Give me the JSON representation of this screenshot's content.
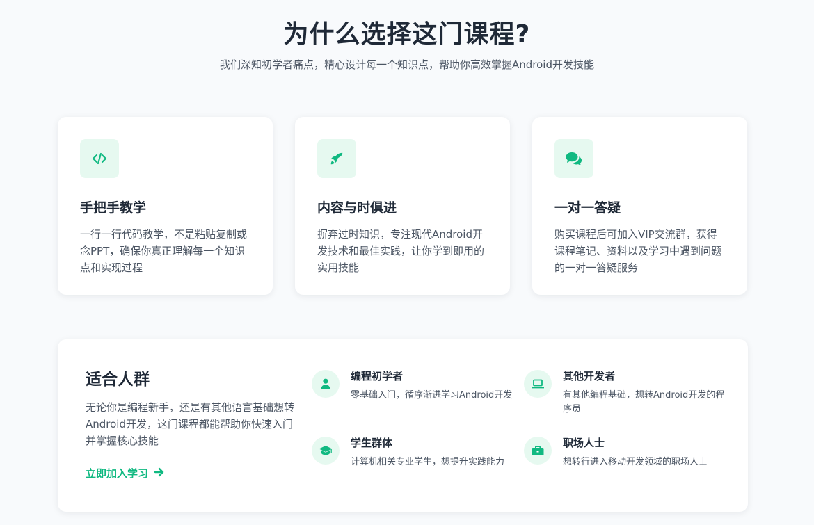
{
  "header": {
    "title": "为什么选择这门课程?",
    "subtitle": "我们深知初学者痛点，精心设计每一个知识点，帮助你高效掌握Android开发技能"
  },
  "features": [
    {
      "icon": "code-icon",
      "title": "手把手教学",
      "desc": "一行一行代码教学，不是粘贴复制或念PPT，确保你真正理解每一个知识点和实现过程"
    },
    {
      "icon": "rocket-icon",
      "title": "内容与时俱进",
      "desc": "摒弃过时知识，专注现代Android开发技术和最佳实践，让你学到即用的实用技能"
    },
    {
      "icon": "chat-icon",
      "title": "一对一答疑",
      "desc": "购买课程后可加入VIP交流群，获得课程笔记、资料以及学习中遇到问题的一对一答疑服务"
    }
  ],
  "audience": {
    "title": "适合人群",
    "desc": "无论你是编程新手，还是有其他语言基础想转Android开发，这门课程都能帮助你快速入门并掌握核心技能",
    "cta_label": "立即加入学习",
    "groups": [
      {
        "icon": "user-icon",
        "title": "编程初学者",
        "desc": "零基础入门，循序渐进学习Android开发"
      },
      {
        "icon": "laptop-icon",
        "title": "其他开发者",
        "desc": "有其他编程基础，想转Android开发的程序员"
      },
      {
        "icon": "graduation-cap-icon",
        "title": "学生群体",
        "desc": "计算机相关专业学生，想提升实践能力"
      },
      {
        "icon": "briefcase-icon",
        "title": "职场人士",
        "desc": "想转行进入移动开发领域的职场人士"
      }
    ]
  },
  "colors": {
    "accent": "#10b981",
    "accent_bg": "#e6f9f0",
    "page_bg": "#f8fafc",
    "text": "#1f2937",
    "muted": "#4b5563"
  }
}
